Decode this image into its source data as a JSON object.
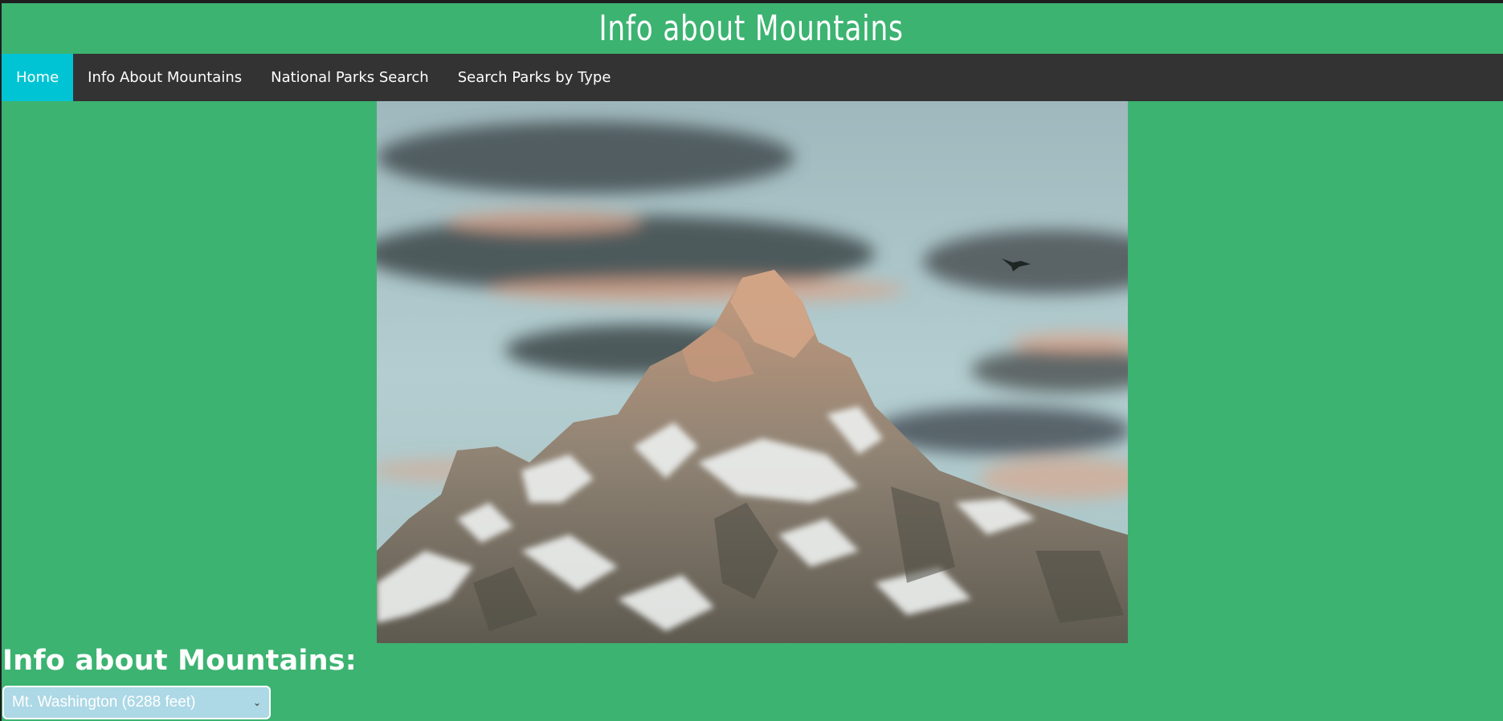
{
  "header": {
    "title": "Info about Mountains"
  },
  "nav": {
    "items": [
      {
        "label": "Home",
        "active": true
      },
      {
        "label": "Info About Mountains",
        "active": false
      },
      {
        "label": "National Parks Search",
        "active": false
      },
      {
        "label": "Search Parks by Type",
        "active": false
      }
    ]
  },
  "main": {
    "hero_image": "mountain-peak-photo",
    "heading": "Info about Mountains:",
    "mountain_select": {
      "selected": "Mt. Washington (6288 feet)",
      "icon": "chevron-down-icon"
    }
  },
  "colors": {
    "page_background": "#3cb371",
    "nav_background": "#333333",
    "nav_active": "#00c4d4",
    "select_background": "#add8e6"
  }
}
